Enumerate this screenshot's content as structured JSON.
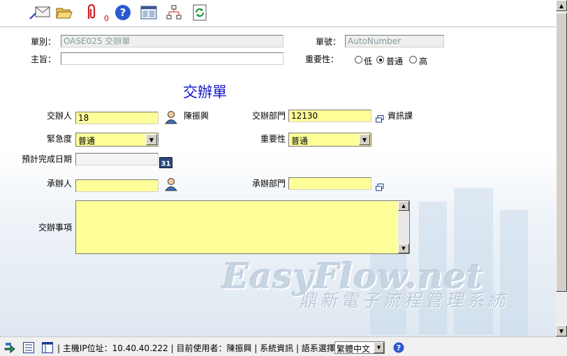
{
  "toolbar": {
    "buttons": [
      {
        "icon": "mail-icon"
      },
      {
        "icon": "folder-open-icon"
      },
      {
        "icon": "paperclip-icon"
      },
      {
        "icon": "help-icon"
      },
      {
        "icon": "form-list-icon"
      },
      {
        "icon": "org-tree-icon"
      },
      {
        "icon": "refresh-icon"
      }
    ],
    "attachment_count": "0"
  },
  "header": {
    "form_type_label": "單別：",
    "form_type_value": "OASE025 交辦單",
    "form_no_label": "單號：",
    "form_no_value": "AutoNumber",
    "subject_label": "主旨：",
    "subject_value": "",
    "importance_label": "重要性：",
    "importance_options": [
      "低",
      "普通",
      "高"
    ],
    "importance_selected": "普通"
  },
  "form": {
    "title": "交辦單",
    "assigner_label": "交辦人",
    "assigner_value": "18",
    "assigner_name": "陳振興",
    "assigner_dept_label": "交辦部門",
    "assigner_dept_value": "12130",
    "assigner_dept_name": "資訊課",
    "urgency_label": "緊急度",
    "urgency_value": "普通",
    "importance_label": "重要性",
    "importance_value": "普通",
    "due_date_label": "預計完成日期",
    "due_date_value": "",
    "calendar_text": "31",
    "handler_label": "承辦人",
    "handler_value": "",
    "handler_dept_label": "承辦部門",
    "handler_dept_value": "",
    "matter_label": "交辦事項",
    "matter_value": ""
  },
  "watermark": {
    "brand": "EasyFlow.net",
    "tagline": "鼎新電子流程管理系統"
  },
  "status_bar": {
    "text": "| 主機IP位址：10.40.40.222 | 目前使用者：陳振興 | 系統資訊 | 語系選擇",
    "language_value": "繁體中文"
  },
  "colors": {
    "required_field": "#ffff99",
    "title": "#1515c8",
    "readonly_field": "#eef0ef"
  }
}
